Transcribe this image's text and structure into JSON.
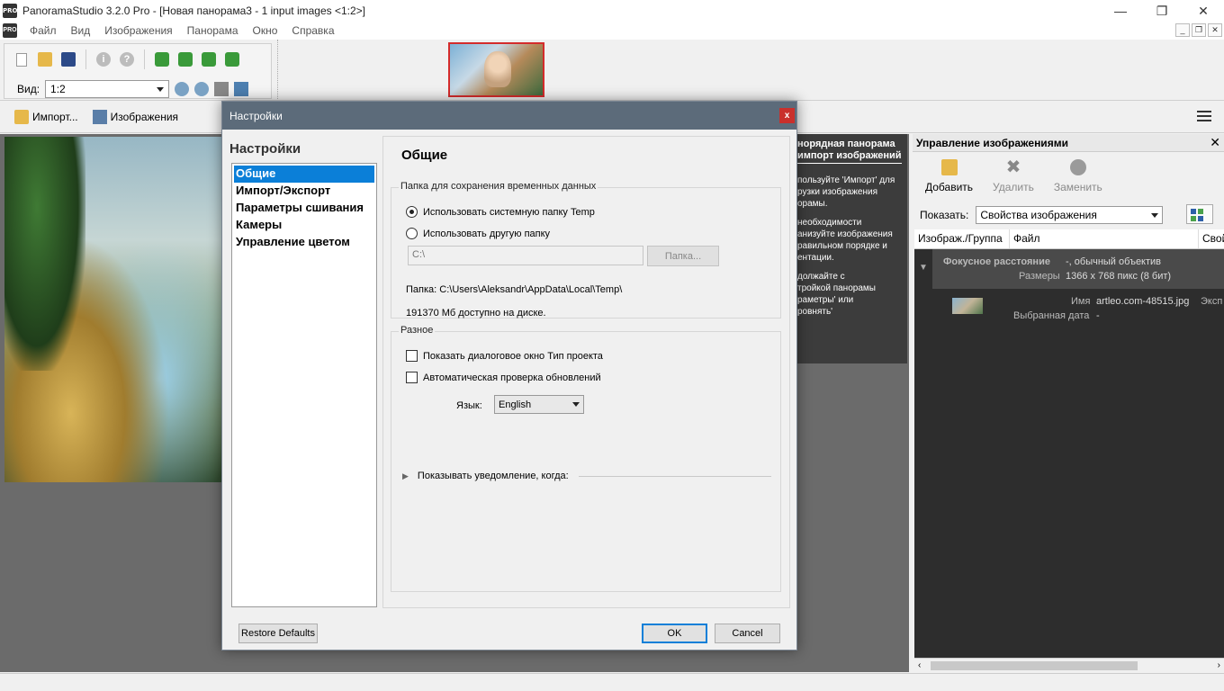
{
  "window": {
    "title": "PanoramaStudio 3.2.0 Pro - [Новая панорама3 - 1 input images <1:2>]",
    "app_icon_text": "PRO",
    "controls": {
      "minimize": "—",
      "maximize": "❐",
      "close": "✕"
    }
  },
  "menu": {
    "items": [
      "Файл",
      "Вид",
      "Изображения",
      "Панорама",
      "Окно",
      "Справка"
    ],
    "mdi_controls": [
      "_",
      "❐",
      "✕"
    ]
  },
  "toolbar": {
    "view_label": "Вид:",
    "view_value": "1:2"
  },
  "toolbar2": {
    "import_label": "Импорт...",
    "images_label": "Изображения"
  },
  "tip_panel": {
    "title_line1": "норядная панорама",
    "title_line2": "импорт изображений",
    "paragraphs": [
      "пользуйте 'Импорт' для\nрузки изображения\nорамы.",
      "необходимости\nанизуйте изображения\nравильном порядке и\nентации.",
      "должайте с\nтройкой панорамы\nраметры' или\nровнять'"
    ]
  },
  "right_panel": {
    "title": "Управление изображениями",
    "close": "✕",
    "actions": [
      {
        "label": "Добавить",
        "icon": "add-image-icon"
      },
      {
        "label": "Удалить",
        "icon": "delete-icon"
      },
      {
        "label": "Заменить",
        "icon": "replace-icon"
      }
    ],
    "show_label": "Показать:",
    "show_value": "Свойства изображения",
    "columns": [
      "Изображ./Группа",
      "Файл",
      "Свой"
    ],
    "group": {
      "focal_label": "Фокусное расстояние",
      "focal_value": "-, обычный объектив",
      "size_label": "Размеры",
      "size_value": "1366 x 768 пикс (8 бит)"
    },
    "row": {
      "name_label": "Имя",
      "name_value": "artleo.com-48515.jpg",
      "extra": "Эксп",
      "date_label": "Выбранная дата",
      "date_value": "-"
    }
  },
  "dialog": {
    "title": "Настройки",
    "close": "x",
    "nav_title": "Настройки",
    "nav_items": [
      "Общие",
      "Импорт/Экспорт",
      "Параметры сшивания",
      "Камеры",
      "Управление цветом"
    ],
    "content_title": "Общие",
    "temp_group": {
      "legend": "Папка для сохранения временных данных",
      "radio_system": "Использовать системную папку Temp",
      "radio_other": "Использовать другую папку",
      "path_value": "C:\\",
      "folder_button": "Папка...",
      "path_line1": "Папка: C:\\Users\\Aleksandr\\AppData\\Local\\Temp\\",
      "path_line2": "191370 Мб доступно на диске."
    },
    "misc_group": {
      "legend": "Разное",
      "check_project_type": "Показать диалоговое окно Тип проекта",
      "check_updates": "Автоматическая проверка обновлений",
      "language_label": "Язык:",
      "language_value": "English",
      "notify_label": "Показывать уведомление, когда:"
    },
    "buttons": {
      "restore": "Restore Defaults",
      "ok": "OK",
      "cancel": "Cancel"
    }
  }
}
